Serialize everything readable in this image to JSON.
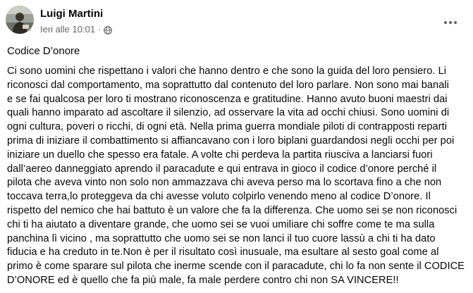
{
  "post": {
    "author": "Luigi Martini",
    "timestamp": "Ieri alle 10:01",
    "separator": "·",
    "privacy_icon": "globe-icon",
    "menu_icon": "more-options-icon",
    "title": "Codice D’onore",
    "body_lines": [
      "Ci sono uomini che rispettano i valori che hanno dentro e che sono la guida del loro pensiero. Li",
      "riconosci dal comportamento, ma soprattutto dal contenuto del loro parlare. Non sono mai banali",
      "e se fai qualcosa per loro ti mostrano riconoscenza e gratitudine. Hanno avuto buoni maestri dai",
      "quali hanno imparato ad ascoltare il silenzio, ad osservare la vita ad occhi chiusi. Sono uomini di",
      "ogni cultura, poveri o ricchi, di ogni età. Nella prima guerra mondiale piloti di contrapposti reparti",
      "prima di iniziare il combattimento si affiancavano con i loro biplani guardandosi negli occhi per poi",
      "iniziare un duello che spesso era fatale. A volte chi perdeva la partita riusciva a lanciarsi fuori",
      "dall’aereo danneggiato aprendo il paracadute e qui entrava in gioco il codice d’onore perché il",
      "pilota che aveva vinto non solo non ammazzava chi aveva perso ma lo scortava fino a che non",
      "toccava terra,lo proteggeva da chi avesse voluto colpirlo venendo meno al codice D’onore. Il",
      "rispetto del nemico che hai battuto è un valore che fa la differenza. Che uomo sei se non riconosci",
      "chi ti ha aiutato a diventare grande, che uomo sei se vuoi umiliare chi soffre come te ma sulla",
      "panchina lì vicino , ma soprattutto che uomo sei se non lanci il tuo cuore lassù a chi ti ha dato",
      "fiducia e ha creduto in te.Non è per il risultato così inusuale, ma esultare al sesto goal come al",
      "primo è come sparare sul pilota che inerme scende con il paracadute, chi lo fa non sente il CODICE",
      "D’ONORE ed è quello che fa più male, fa male perdere contro chi non SA VINCERE!!"
    ]
  }
}
